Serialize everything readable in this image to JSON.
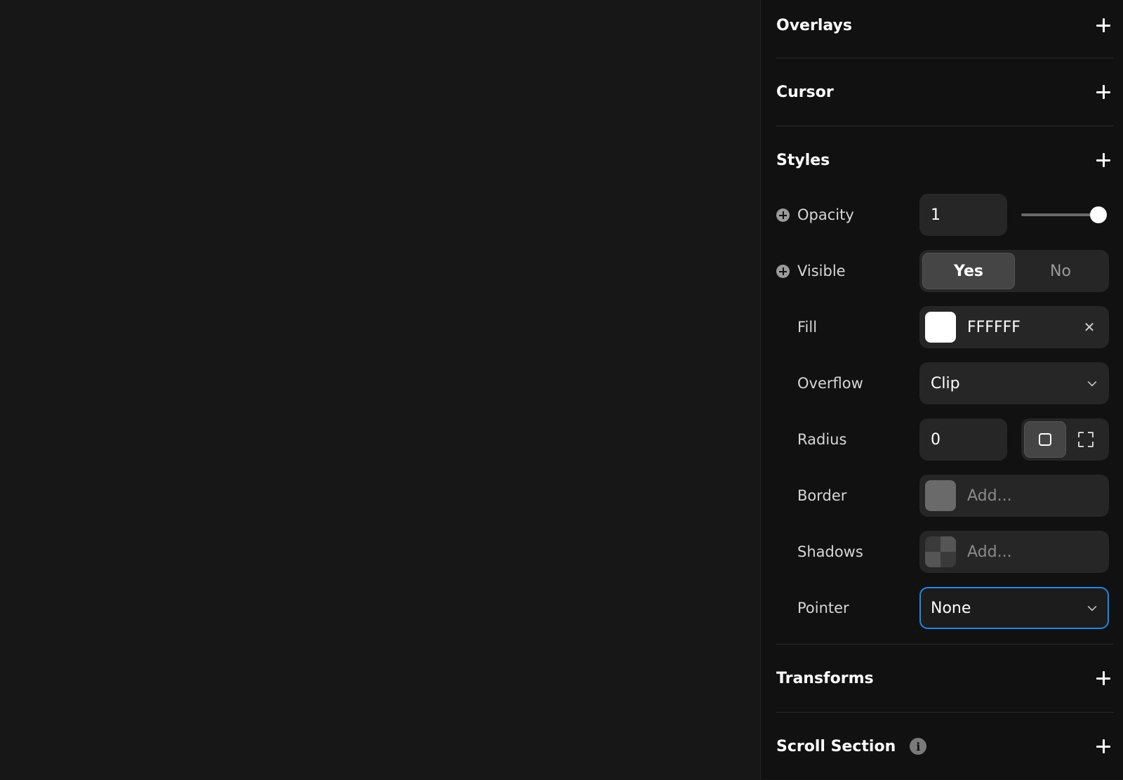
{
  "sections": {
    "overlays": "Overlays",
    "cursor": "Cursor",
    "styles": "Styles",
    "transforms": "Transforms",
    "scroll_section": "Scroll Section"
  },
  "styles": {
    "opacity": {
      "label": "Opacity",
      "value": "1",
      "slider_level": 1.0
    },
    "visible": {
      "label": "Visible",
      "options": [
        "Yes",
        "No"
      ],
      "selected": "Yes"
    },
    "fill": {
      "label": "Fill",
      "value": "FFFFFF",
      "swatch_color": "#FFFFFF"
    },
    "overflow": {
      "label": "Overflow",
      "value": "Clip"
    },
    "radius": {
      "label": "Radius",
      "value": "0",
      "mode": "uniform"
    },
    "border": {
      "label": "Border",
      "placeholder": "Add..."
    },
    "shadows": {
      "label": "Shadows",
      "placeholder": "Add..."
    },
    "pointer": {
      "label": "Pointer",
      "value": "None"
    }
  },
  "colors": {
    "canvas_bg": "#171717",
    "panel_bg": "#111111",
    "field_bg": "#262626",
    "focus_accent": "#1E88E5"
  },
  "icons": [
    "plus-icon",
    "info-icon",
    "add-property-icon",
    "close-icon",
    "chevron-down-icon",
    "square-icon",
    "corners-icon"
  ]
}
